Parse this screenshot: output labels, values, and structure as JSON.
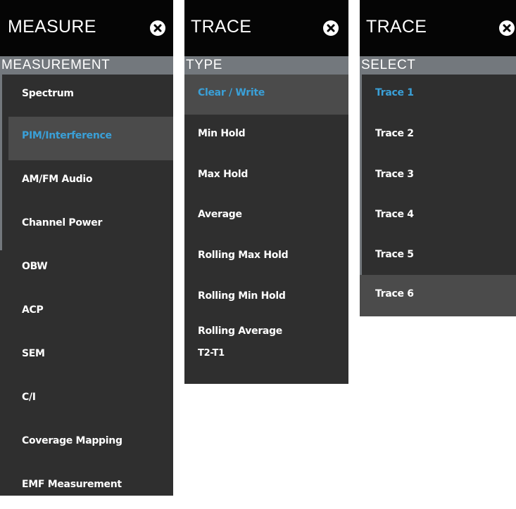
{
  "measure_panel": {
    "title": "MEASURE",
    "close_icon": "close-circle-icon",
    "section_label": "MEASUREMENT",
    "items": [
      {
        "label": "Spectrum",
        "selected": false
      },
      {
        "label": "PIM/Interference",
        "selected": true
      },
      {
        "label": "AM/FM Audio",
        "selected": false
      },
      {
        "label": "Channel Power",
        "selected": false
      },
      {
        "label": "OBW",
        "selected": false
      },
      {
        "label": "ACP",
        "selected": false
      },
      {
        "label": "SEM",
        "selected": false
      },
      {
        "label": "C/I",
        "selected": false
      },
      {
        "label": "Coverage Mapping",
        "selected": false
      },
      {
        "label": "EMF Measurement",
        "selected": false
      }
    ]
  },
  "trace_type_panel": {
    "title": "TRACE",
    "close_icon": "close-circle-icon",
    "section_label": "TYPE",
    "items": [
      {
        "label": "Clear / Write",
        "selected": true
      },
      {
        "label": "Min Hold",
        "selected": false
      },
      {
        "label": "Max Hold",
        "selected": false
      },
      {
        "label": "Average",
        "selected": false
      },
      {
        "label": "Rolling Max Hold",
        "selected": false
      },
      {
        "label": "Rolling Min Hold",
        "selected": false
      },
      {
        "label": "Rolling Average",
        "selected": false
      }
    ],
    "extra_item": "T2-T1"
  },
  "trace_select_panel": {
    "title": "TRACE",
    "close_icon": "close-circle-icon",
    "section_label": "SELECT",
    "items": [
      {
        "label": "Trace 1",
        "selected": true
      },
      {
        "label": "Trace 2",
        "selected": false
      },
      {
        "label": "Trace 3",
        "selected": false
      },
      {
        "label": "Trace 4",
        "selected": false
      },
      {
        "label": "Trace 5",
        "selected": false
      },
      {
        "label": "Trace 6",
        "selected": false
      }
    ]
  },
  "colors": {
    "header_bg": "#050505",
    "panel_bg": "#2f2f2f",
    "section_bg": "#73787d",
    "highlight_bg": "#4b4b4b",
    "accent_text": "#3aa0d8",
    "text": "#ffffff"
  }
}
